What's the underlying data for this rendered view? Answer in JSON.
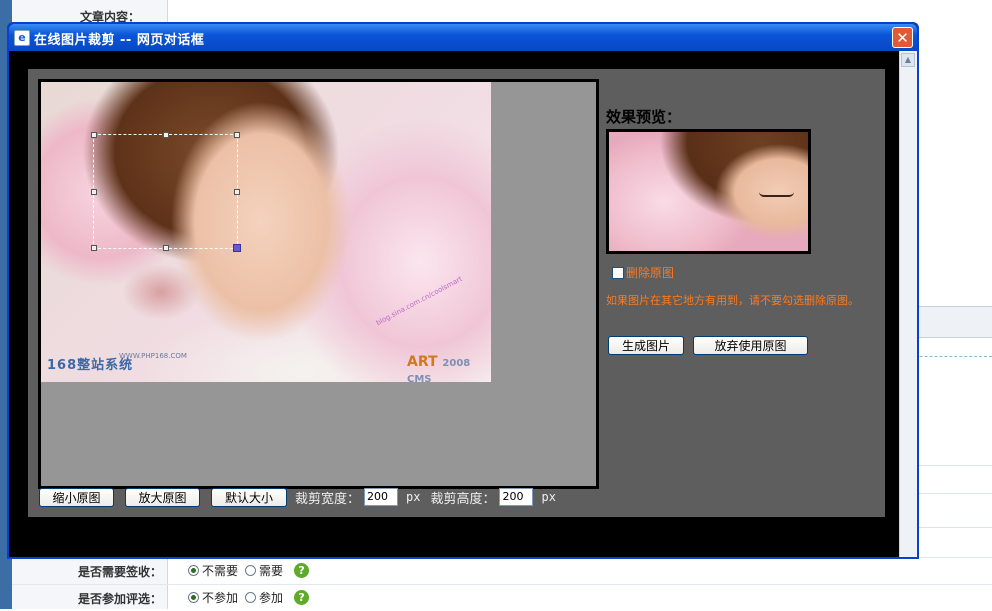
{
  "background_page": {
    "top_label": "文章内容：",
    "rows": [
      {
        "label": "是否需要签收：",
        "options": [
          "不需要",
          "需要"
        ],
        "selected": 0
      },
      {
        "label": "是否参加评选：",
        "options": [
          "不参加",
          "参加"
        ],
        "selected": 0
      }
    ],
    "help_glyph": "?"
  },
  "dialog": {
    "title": "在线图片裁剪  --  网页对话框",
    "app_icon": "e",
    "close_glyph": "✕"
  },
  "crop": {
    "watermark_logo": "168整站系统",
    "watermark_url": "WWW.PHP168.COM",
    "watermark_blog": "blog.sina.com.cn/coolsmart",
    "watermark_brand": "ART",
    "watermark_brand_cms": "2008 CMS",
    "buttons": {
      "shrink": "缩小原图",
      "enlarge": "放大原图",
      "default": "默认大小"
    },
    "width_label": "裁剪宽度：",
    "width_value": "200",
    "height_label": "裁剪高度：",
    "height_value": "200",
    "unit": "px"
  },
  "preview": {
    "title": "效果预览：",
    "delete_label": "删除原图",
    "delete_checked": false,
    "warning": "如果图片在其它地方有用到，请不要勾选删除原图。",
    "generate_button": "生成图片",
    "discard_button": "放弃使用原图"
  },
  "colors": {
    "title_bar": "#0a55d8",
    "warning": "#ff7a1a",
    "panel": "#5e5e5e",
    "crop_area": "#969696"
  }
}
